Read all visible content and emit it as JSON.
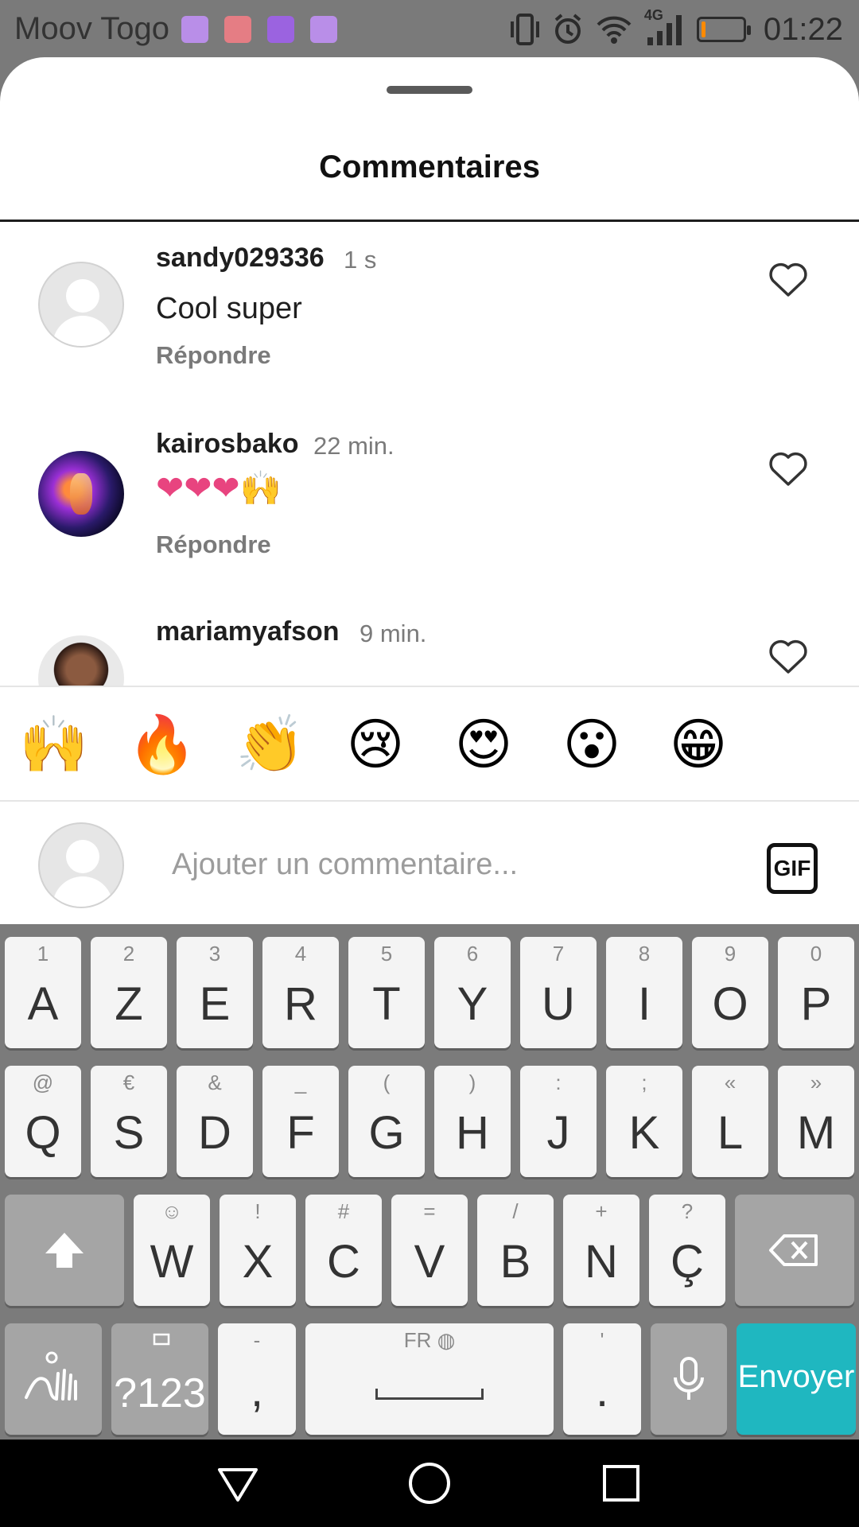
{
  "status_bar": {
    "carrier": "Moov Togo",
    "notification_colors": [
      "#b98ee8",
      "#e57d84",
      "#9b63e0",
      "#b98ee8"
    ],
    "network": "4G",
    "time": "01:22",
    "battery_color": "#ff8a00"
  },
  "sheet": {
    "title": "Commentaires",
    "comments": [
      {
        "username": "sandy029336",
        "time": "1 s",
        "text": "Cool super",
        "reply": "Répondre",
        "avatar": "default"
      },
      {
        "username": "kairosbako",
        "time": "22 min.",
        "text": "❤❤❤🙌",
        "reply": "Répondre",
        "avatar": "lion-picture"
      },
      {
        "username": "mariamyafson",
        "time": "9 min.",
        "text": "",
        "reply": "",
        "avatar": "person-picture"
      }
    ],
    "quick_emojis": [
      "🙌",
      "🔥",
      "👏",
      "😢",
      "😍",
      "😮",
      "😁"
    ],
    "input_placeholder": "Ajouter un commentaire...",
    "gif_label": "GIF"
  },
  "keyboard": {
    "row1": [
      {
        "main": "A",
        "sub": "1"
      },
      {
        "main": "Z",
        "sub": "2"
      },
      {
        "main": "E",
        "sub": "3"
      },
      {
        "main": "R",
        "sub": "4"
      },
      {
        "main": "T",
        "sub": "5"
      },
      {
        "main": "Y",
        "sub": "6"
      },
      {
        "main": "U",
        "sub": "7"
      },
      {
        "main": "I",
        "sub": "8"
      },
      {
        "main": "O",
        "sub": "9"
      },
      {
        "main": "P",
        "sub": "0"
      }
    ],
    "row2": [
      {
        "main": "Q",
        "sub": "@"
      },
      {
        "main": "S",
        "sub": "€"
      },
      {
        "main": "D",
        "sub": "&"
      },
      {
        "main": "F",
        "sub": "_"
      },
      {
        "main": "G",
        "sub": "("
      },
      {
        "main": "H",
        "sub": ")"
      },
      {
        "main": "J",
        "sub": ":"
      },
      {
        "main": "K",
        "sub": ";"
      },
      {
        "main": "L",
        "sub": "«"
      },
      {
        "main": "M",
        "sub": "»"
      }
    ],
    "row3": [
      {
        "main": "W",
        "sub": "☺"
      },
      {
        "main": "X",
        "sub": "!"
      },
      {
        "main": "C",
        "sub": "#"
      },
      {
        "main": "V",
        "sub": "="
      },
      {
        "main": "B",
        "sub": "/"
      },
      {
        "main": "N",
        "sub": "+"
      },
      {
        "main": "Ç",
        "sub": "?"
      }
    ],
    "symbols_label": "?123",
    "comma": {
      "main": ",",
      "sub": "-"
    },
    "space_label": "FR",
    "period": {
      "main": ".",
      "sub": "'"
    },
    "enter_label": "Envoyer",
    "accent_color": "#1fb7c0"
  },
  "nav_bar": {
    "buttons": [
      "back-icon",
      "home-icon",
      "recents-icon"
    ]
  }
}
